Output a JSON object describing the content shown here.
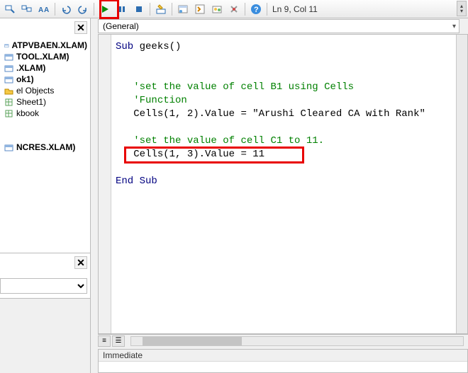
{
  "toolbar": {
    "status_position": "Ln 9, Col 11"
  },
  "project_tree": {
    "items": [
      {
        "label": "ATPVBAEN.XLAM)",
        "bold": true,
        "icon": "vbp"
      },
      {
        "label": "TOOL.XLAM)",
        "bold": true,
        "icon": "vbp"
      },
      {
        "label": ".XLAM)",
        "bold": true,
        "icon": "vbp"
      },
      {
        "label": "ok1)",
        "bold": true,
        "icon": "vbp"
      },
      {
        "label": "el Objects",
        "bold": false,
        "icon": "folder"
      },
      {
        "label": "Sheet1)",
        "bold": false,
        "icon": "sheet"
      },
      {
        "label": "kbook",
        "bold": false,
        "icon": "sheet"
      },
      {
        "label": "",
        "bold": false,
        "icon": "none"
      },
      {
        "label": "",
        "bold": false,
        "icon": "none"
      },
      {
        "label": "NCRES.XLAM)",
        "bold": true,
        "icon": "vbp"
      }
    ]
  },
  "object_dropdown": {
    "selected": "(General)"
  },
  "code": {
    "sub_kw": "Sub",
    "sub_name": " geeks()",
    "comment1": "'set the value of cell B1 using Cells",
    "comment2": "'Function",
    "line1a": "Cells(1, 2).Value = ",
    "line1b": "\"Arushi Cleared CA with Rank\"",
    "comment3": "'set the value of cell C1 to 11.",
    "line2": "Cells(1, 3).Value = 11",
    "end_kw": "End Sub"
  },
  "immediate": {
    "title": "Immediate"
  }
}
